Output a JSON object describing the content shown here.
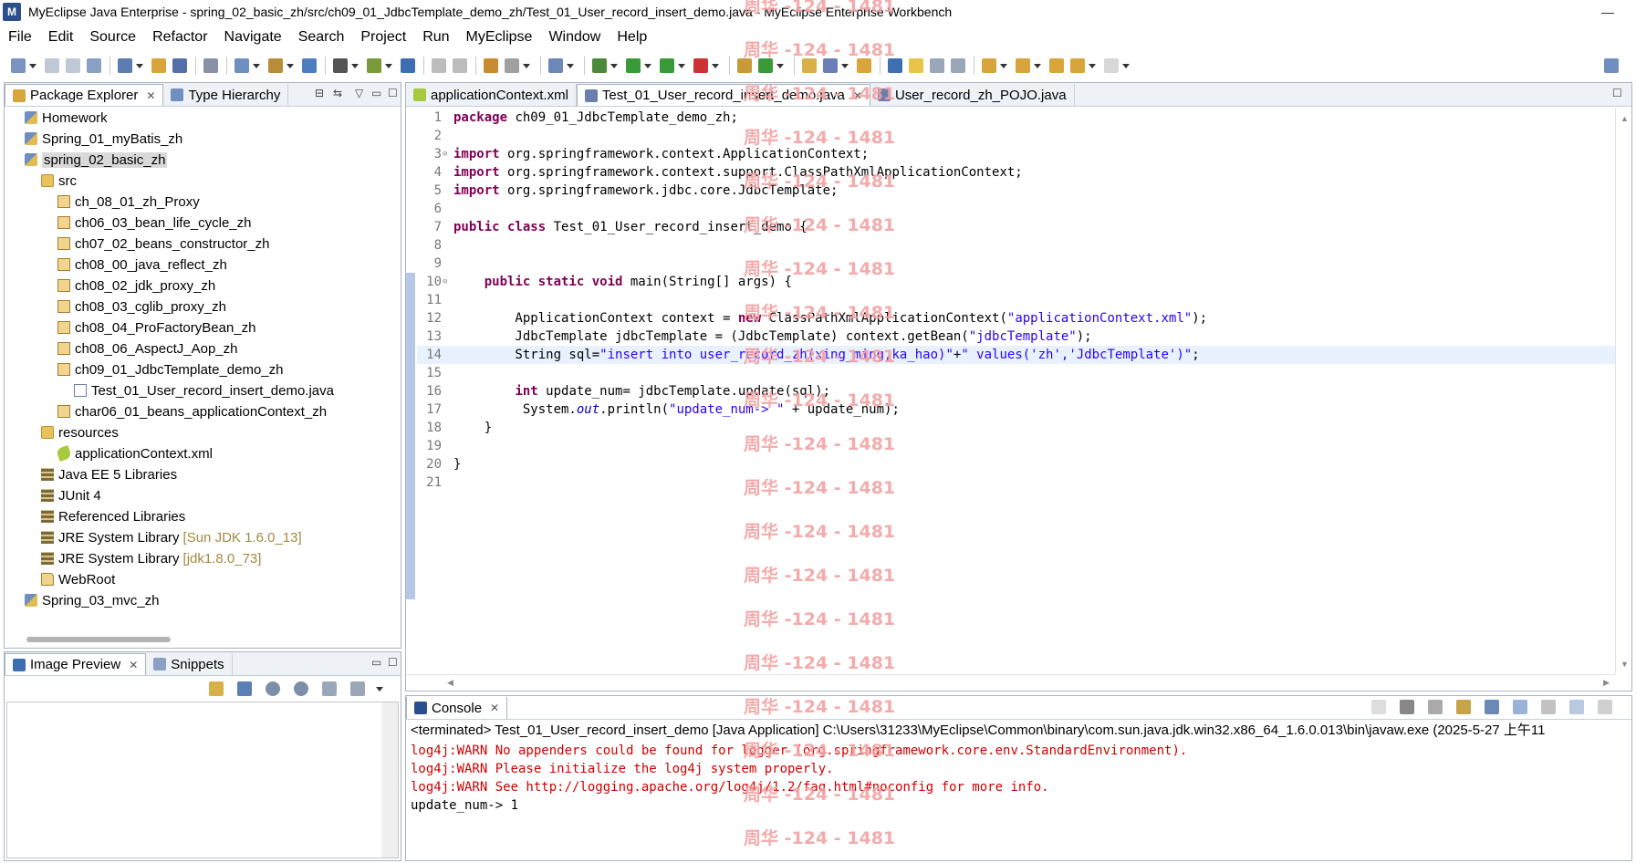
{
  "window": {
    "title": "MyEclipse Java Enterprise - spring_02_basic_zh/src/ch09_01_JdbcTemplate_demo_zh/Test_01_User_record_insert_demo.java - MyEclipse Enterprise Workbench",
    "minimize": "—",
    "maximize": "☐"
  },
  "menu": [
    "File",
    "Edit",
    "Source",
    "Refactor",
    "Navigate",
    "Search",
    "Project",
    "Run",
    "MyEclipse",
    "Window",
    "Help"
  ],
  "left_panel": {
    "tabs": [
      {
        "label": "Package Explorer",
        "active": true
      },
      {
        "label": "Type Hierarchy",
        "active": false
      }
    ],
    "tree": [
      {
        "label": "Homework",
        "icon": "project-icon",
        "depth": 0
      },
      {
        "label": "Spring_01_myBatis_zh",
        "icon": "project-icon",
        "depth": 0
      },
      {
        "label": "spring_02_basic_zh",
        "icon": "project-icon",
        "depth": 0,
        "selected": true
      },
      {
        "label": "src",
        "icon": "source-folder-icon",
        "depth": 1
      },
      {
        "label": "ch_08_01_zh_Proxy",
        "icon": "package-icon",
        "depth": 2
      },
      {
        "label": "ch06_03_bean_life_cycle_zh",
        "icon": "package-icon",
        "depth": 2
      },
      {
        "label": "ch07_02_beans_constructor_zh",
        "icon": "package-icon",
        "depth": 2
      },
      {
        "label": "ch08_00_java_reflect_zh",
        "icon": "package-icon",
        "depth": 2
      },
      {
        "label": "ch08_02_jdk_proxy_zh",
        "icon": "package-icon",
        "depth": 2
      },
      {
        "label": "ch08_03_cglib_proxy_zh",
        "icon": "package-icon",
        "depth": 2
      },
      {
        "label": "ch08_04_ProFactoryBean_zh",
        "icon": "package-icon",
        "depth": 2
      },
      {
        "label": "ch08_06_AspectJ_Aop_zh",
        "icon": "package-icon",
        "depth": 2
      },
      {
        "label": "ch09_01_JdbcTemplate_demo_zh",
        "icon": "package-icon",
        "depth": 2
      },
      {
        "label": "Test_01_User_record_insert_demo.java",
        "icon": "java-file-icon",
        "depth": 3
      },
      {
        "label": "char06_01_beans_applicationContext_zh",
        "icon": "package-icon",
        "depth": 2
      },
      {
        "label": "resources",
        "icon": "source-folder-icon",
        "depth": 1
      },
      {
        "label": "applicationContext.xml",
        "icon": "xml-file-icon",
        "depth": 2
      },
      {
        "label": "Java EE 5 Libraries",
        "icon": "library-icon",
        "depth": 1
      },
      {
        "label": "JUnit 4",
        "icon": "library-icon",
        "depth": 1
      },
      {
        "label": "Referenced Libraries",
        "icon": "library-icon",
        "depth": 1
      },
      {
        "label": "JRE System Library",
        "decoration": "[Sun JDK 1.6.0_13]",
        "icon": "library-icon",
        "depth": 1
      },
      {
        "label": "JRE System Library",
        "decoration": "[jdk1.8.0_73]",
        "icon": "library-icon",
        "depth": 1
      },
      {
        "label": "WebRoot",
        "icon": "folder-icon",
        "depth": 1
      },
      {
        "label": "Spring_03_mvc_zh",
        "icon": "project-icon",
        "depth": 0
      }
    ]
  },
  "bottom_left_panel": {
    "tabs": [
      {
        "label": "Image Preview",
        "active": true
      },
      {
        "label": "Snippets",
        "active": false
      }
    ]
  },
  "editor": {
    "tabs": [
      {
        "label": "applicationContext.xml",
        "active": false
      },
      {
        "label": "Test_01_User_record_insert_demo.java",
        "active": true
      },
      {
        "label": "User_record_zh_POJO.java",
        "active": false
      }
    ],
    "current_line": 14,
    "lines": [
      {
        "n": "1",
        "segs": [
          {
            "t": "package",
            "c": "kw"
          },
          {
            "t": " ch09_01_JdbcTemplate_demo_zh;"
          }
        ]
      },
      {
        "n": "2",
        "segs": []
      },
      {
        "n": "3",
        "fold": true,
        "segs": [
          {
            "t": "import",
            "c": "kw"
          },
          {
            "t": " org.springframework.context.ApplicationContext;"
          }
        ]
      },
      {
        "n": "4",
        "segs": [
          {
            "t": "import",
            "c": "kw"
          },
          {
            "t": " org.springframework.context.support.ClassPathXmlApplicationContext;"
          }
        ]
      },
      {
        "n": "5",
        "segs": [
          {
            "t": "import",
            "c": "kw"
          },
          {
            "t": " org.springframework.jdbc.core.JdbcTemplate;"
          }
        ]
      },
      {
        "n": "6",
        "segs": []
      },
      {
        "n": "7",
        "segs": [
          {
            "t": "public class",
            "c": "kw"
          },
          {
            "t": " Test_01_User_record_insert_demo {"
          }
        ]
      },
      {
        "n": "8",
        "segs": []
      },
      {
        "n": "9",
        "segs": []
      },
      {
        "n": "10",
        "fold": true,
        "segs": [
          {
            "t": "    "
          },
          {
            "t": "public static void",
            "c": "kw"
          },
          {
            "t": " main(String[] args) {"
          }
        ]
      },
      {
        "n": "11",
        "segs": []
      },
      {
        "n": "12",
        "segs": [
          {
            "t": "        ApplicationContext context = "
          },
          {
            "t": "new",
            "c": "kw"
          },
          {
            "t": " ClassPathXmlApplicationContext("
          },
          {
            "t": "\"applicationContext.xml\"",
            "c": "str"
          },
          {
            "t": ");"
          }
        ]
      },
      {
        "n": "13",
        "segs": [
          {
            "t": "        JdbcTemplate jdbcTemplate = (JdbcTemplate) context.getBean("
          },
          {
            "t": "\"jdbcTemplate\"",
            "c": "str"
          },
          {
            "t": ");"
          }
        ]
      },
      {
        "n": "14",
        "segs": [
          {
            "t": "        String sql="
          },
          {
            "t": "\"insert into user_record_zh(xing_ming,ka_hao)\"",
            "c": "str"
          },
          {
            "t": "+"
          },
          {
            "t": "\" values('zh','JdbcTemplate')\"",
            "c": "str"
          },
          {
            "t": ";"
          }
        ]
      },
      {
        "n": "15",
        "segs": []
      },
      {
        "n": "16",
        "segs": [
          {
            "t": "        "
          },
          {
            "t": "int",
            "c": "kw"
          },
          {
            "t": " update_num= jdbcTemplate.update(sql);"
          }
        ]
      },
      {
        "n": "17",
        "segs": [
          {
            "t": "         System."
          },
          {
            "t": "out",
            "c": "it"
          },
          {
            "t": ".println("
          },
          {
            "t": "\"update_num-> \"",
            "c": "str"
          },
          {
            "t": " + update_num);"
          }
        ]
      },
      {
        "n": "18",
        "segs": [
          {
            "t": "    }"
          }
        ]
      },
      {
        "n": "19",
        "segs": []
      },
      {
        "n": "20",
        "segs": [
          {
            "t": "}"
          }
        ]
      },
      {
        "n": "21",
        "segs": []
      }
    ]
  },
  "console": {
    "tab_label": "Console",
    "header": "<terminated> Test_01_User_record_insert_demo [Java Application] C:\\Users\\31233\\MyEclipse\\Common\\binary\\com.sun.java.jdk.win32.x86_64_1.6.0.013\\bin\\javaw.exe (2025-5-27 上午11",
    "lines": [
      {
        "text": "log4j:WARN No appenders could be found for logger (org.springframework.core.env.StandardEnvironment).",
        "warn": true
      },
      {
        "text": "log4j:WARN Please initialize the log4j system properly.",
        "warn": true
      },
      {
        "text": "log4j:WARN See http://logging.apache.org/log4j/1.2/faq.html#noconfig for more info.",
        "warn": true
      },
      {
        "text": "update_num-> 1",
        "warn": false
      }
    ]
  },
  "watermark": "周华 -124 - 1481",
  "colors": {
    "keyword": "#7f0055",
    "string": "#2a00ff",
    "warning": "#d10000",
    "watermark": "#f2a2a2"
  }
}
